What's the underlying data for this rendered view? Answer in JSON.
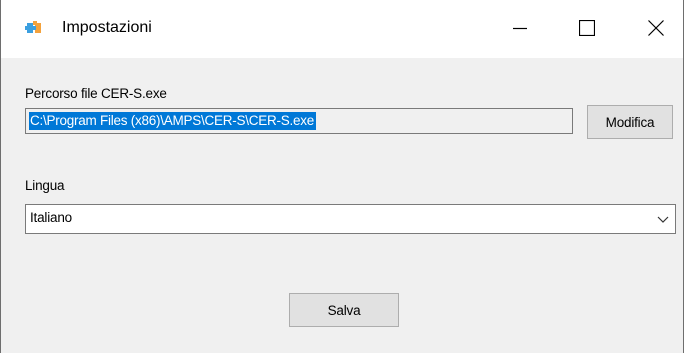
{
  "window": {
    "title": "Impostazioni",
    "icon": "puzzle-app-icon",
    "controls": {
      "minimize": "minimize-icon",
      "maximize": "maximize-icon",
      "close": "close-icon"
    }
  },
  "path_section": {
    "label": "Percorso file CER-S.exe",
    "value": "C:\\Program Files (x86)\\AMPS\\CER-S\\CER-S.exe",
    "button_label": "Modifica"
  },
  "language_section": {
    "label": "Lingua",
    "selected": "Italiano"
  },
  "footer": {
    "save_label": "Salva"
  },
  "colors": {
    "selection": "#0078d7",
    "dialog_bg": "#f0f0f0",
    "icon_blue": "#3b9fe0",
    "icon_orange": "#f4a23c"
  }
}
